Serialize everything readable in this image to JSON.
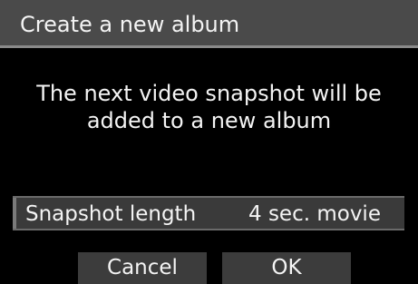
{
  "dialog": {
    "title": "Create a new album",
    "message_line1": "The next video snapshot will be",
    "message_line2": "added to a new album"
  },
  "setting": {
    "label": "Snapshot length",
    "value": "4 sec. movie"
  },
  "buttons": {
    "cancel": "Cancel",
    "ok": "OK"
  }
}
